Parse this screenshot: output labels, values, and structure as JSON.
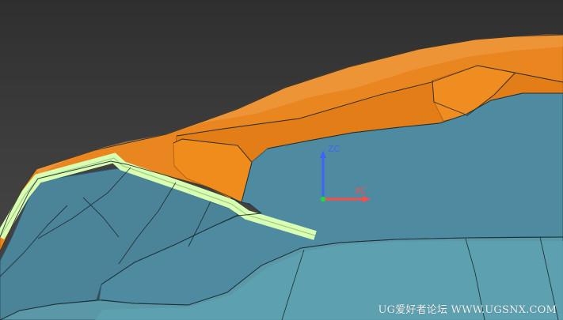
{
  "viewport": {
    "background_top": "#2f2f2f",
    "background_bottom": "#4a4a4a"
  },
  "colors": {
    "orange_face": "#e9861f",
    "orange_dark": "#d06e12",
    "teal_face": "#4f8ba0",
    "teal_dark": "#3f7486",
    "highlight_edge": "#d9ffb3",
    "axis_x": "#ff4a4a",
    "axis_z": "#3f63ff"
  },
  "triad": {
    "z_label": "ZC",
    "x_label": "XC"
  },
  "watermark": "UG爱好者论坛 WWW.UGSNX.COM"
}
